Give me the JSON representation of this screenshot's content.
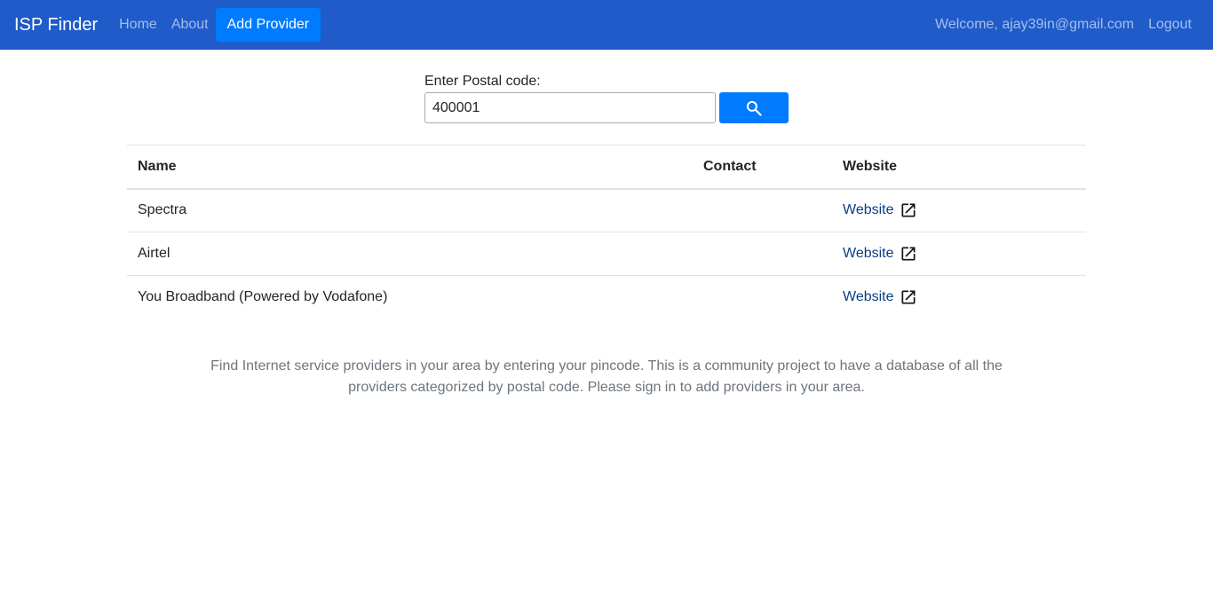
{
  "navbar": {
    "brand": "ISP Finder",
    "links": [
      {
        "label": "Home"
      },
      {
        "label": "About"
      }
    ],
    "add_provider_label": "Add Provider",
    "welcome": "Welcome, ajay39in@gmail.com",
    "logout_label": "Logout",
    "bg_color": "#1f5bc9"
  },
  "search": {
    "label": "Enter Postal code:",
    "value": "400001",
    "button_icon": "search-icon",
    "button_color": "#007bff"
  },
  "table": {
    "headers": [
      "Name",
      "Contact",
      "Website"
    ],
    "rows": [
      {
        "name": "Spectra",
        "contact": "",
        "website": "Website"
      },
      {
        "name": "Airtel",
        "contact": "",
        "website": "Website"
      },
      {
        "name": "You Broadband (Powered by Vodafone)",
        "contact": "",
        "website": "Website"
      }
    ],
    "website_icon": "external-link-icon"
  },
  "footer": {
    "text": "Find Internet service providers in your area by entering your pincode. This is a community project to have a database of all the providers categorized by postal code. Please sign in to add providers in your area."
  }
}
